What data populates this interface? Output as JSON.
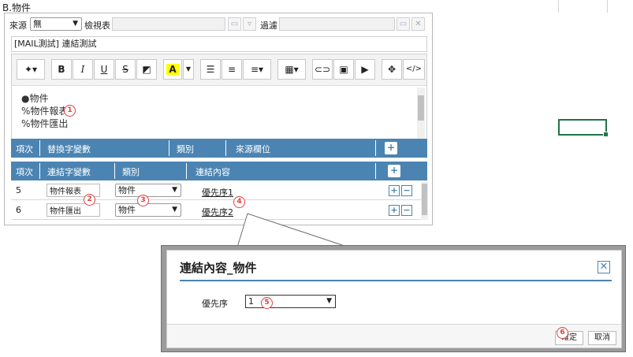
{
  "heading": "B.物件",
  "filter_bar": {
    "source_label": "來源",
    "source_value": "無",
    "view_label": "檢視表",
    "filter_label": "過濾"
  },
  "subject": "[MAIL測試] 連結測試",
  "toolbar": {
    "bold": "B",
    "italic": "I",
    "underline": "U",
    "strike": "S",
    "color": "A",
    "code": "</>"
  },
  "editor_lines": [
    "●物件",
    "%物件報表",
    "%物件匯出"
  ],
  "replace_table": {
    "headers": [
      "項次",
      "替換字變數",
      "類別",
      "來源欄位"
    ]
  },
  "link_table": {
    "headers": [
      "項次",
      "連結字變數",
      "類別",
      "連結內容"
    ],
    "rows": [
      {
        "index": "5",
        "variable": "物件報表",
        "category": "物件",
        "content": "優先序1"
      },
      {
        "index": "6",
        "variable": "物件匯出",
        "category": "物件",
        "content": "優先序2"
      }
    ]
  },
  "callouts": [
    "1",
    "2",
    "3",
    "4",
    "5",
    "6"
  ],
  "dialog": {
    "title": "連結內容_物件",
    "priority_label": "優先序",
    "priority_value": "1",
    "confirm": "確定",
    "cancel": "取消"
  },
  "colors": {
    "header_blue": "#4b84b2",
    "callout_red": "#e04040",
    "sheet_green": "#217346"
  }
}
